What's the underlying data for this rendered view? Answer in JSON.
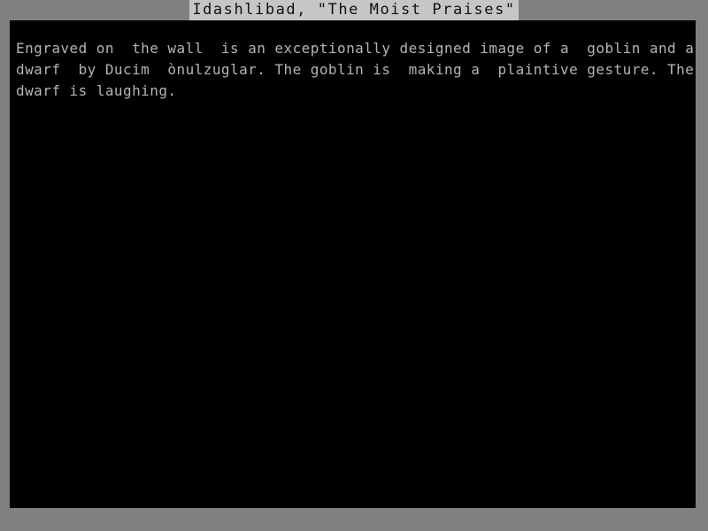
{
  "window": {
    "title": "Idashlibad, \"The Moist Praises\"",
    "background_color": "#808080",
    "content_background_color": "#000000",
    "title_strip_color": "#c6c6c6",
    "title_text_color": "#101010",
    "body_text_color": "#b4b4b4"
  },
  "description": {
    "lines": [
      "Engraved on  the wall  is an exceptionally designed image of a  goblin and a",
      "dwarf  by Ducim  ònulzuglar. The goblin is  making a  plaintive gesture. The",
      "dwarf is laughing."
    ],
    "full_text": "Engraved on the wall is an exceptionally designed image of a goblin and a dwarf by Ducim ònulzuglar. The goblin is making a plaintive gesture. The dwarf is laughing."
  }
}
